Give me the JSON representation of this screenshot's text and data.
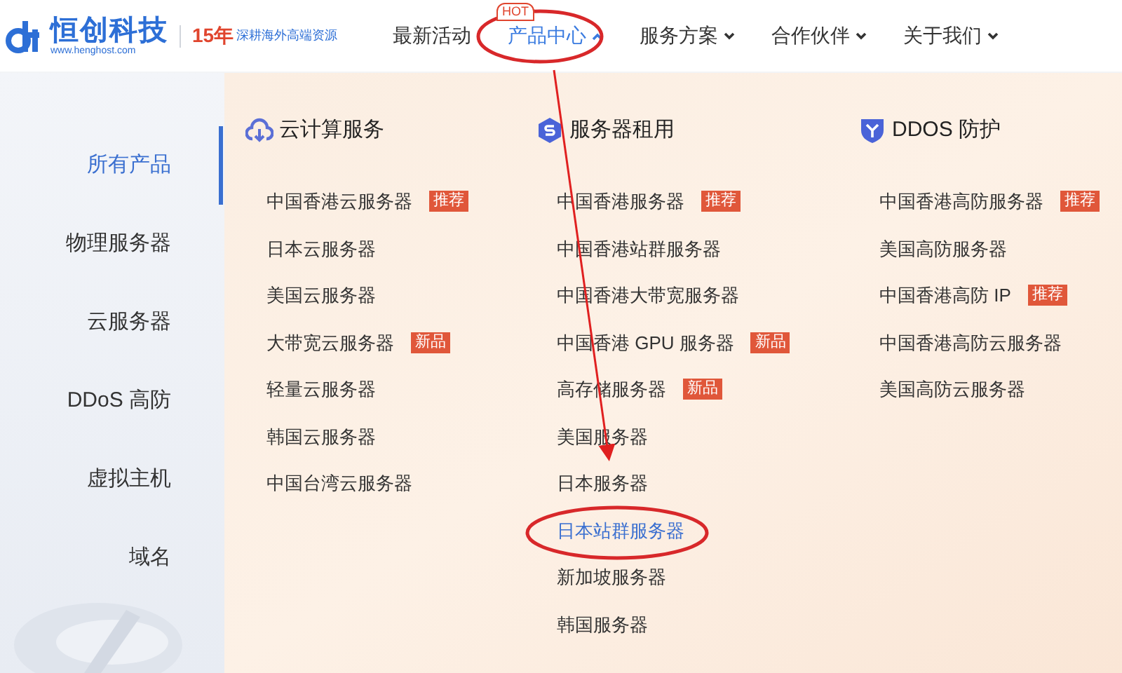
{
  "header": {
    "logo": {
      "name": "恒创科技",
      "url": "www.henghost.com"
    },
    "slogan": {
      "years": "15年",
      "text": "深耕海外高端资源"
    },
    "nav": [
      {
        "label": "最新活动",
        "selected": false,
        "dropdown": false
      },
      {
        "label": "产品中心",
        "selected": true,
        "dropdown": true,
        "badge": "HOT"
      },
      {
        "label": "服务方案",
        "selected": false,
        "dropdown": true
      },
      {
        "label": "合作伙伴",
        "selected": false,
        "dropdown": true
      },
      {
        "label": "关于我们",
        "selected": false,
        "dropdown": true
      }
    ]
  },
  "sidebar": {
    "items": [
      {
        "label": "所有产品",
        "selected": true
      },
      {
        "label": "物理服务器",
        "selected": false
      },
      {
        "label": "云服务器",
        "selected": false
      },
      {
        "label": "DDoS 高防",
        "selected": false
      },
      {
        "label": "虚拟主机",
        "selected": false
      },
      {
        "label": "域名",
        "selected": false
      }
    ]
  },
  "columns": [
    {
      "kind": "cloud",
      "title": "云计算服务",
      "items": [
        {
          "label": "中国香港云服务器",
          "tag": "推荐",
          "selected": false
        },
        {
          "label": "日本云服务器",
          "selected": false
        },
        {
          "label": "美国云服务器",
          "selected": false
        },
        {
          "label": "大带宽云服务器",
          "tag": "新品",
          "selected": false
        },
        {
          "label": "轻量云服务器",
          "selected": false
        },
        {
          "label": "韩国云服务器",
          "selected": false
        },
        {
          "label": "中国台湾云服务器",
          "selected": false
        }
      ]
    },
    {
      "kind": "server",
      "title": "服务器租用",
      "items": [
        {
          "label": "中国香港服务器",
          "tag": "推荐",
          "selected": false
        },
        {
          "label": "中国香港站群服务器",
          "selected": false
        },
        {
          "label": "中国香港大带宽服务器",
          "selected": false
        },
        {
          "label": "中国香港 GPU 服务器",
          "tag": "新品",
          "selected": false
        },
        {
          "label": "高存储服务器",
          "tag": "新品",
          "selected": false
        },
        {
          "label": "美国服务器",
          "selected": false
        },
        {
          "label": "日本服务器",
          "selected": false
        },
        {
          "label": "日本站群服务器",
          "selected": true
        },
        {
          "label": "新加坡服务器",
          "selected": false
        },
        {
          "label": "韩国服务器",
          "selected": false
        }
      ]
    },
    {
      "kind": "shield",
      "title": "DDOS 防护",
      "items": [
        {
          "label": "中国香港高防服务器",
          "tag": "推荐",
          "selected": false
        },
        {
          "label": "美国高防服务器",
          "selected": false
        },
        {
          "label": "中国香港高防 IP",
          "tag": "推荐",
          "selected": false
        },
        {
          "label": "中国香港高防云服务器",
          "selected": false
        },
        {
          "label": "美国高防云服务器",
          "selected": false
        }
      ]
    }
  ]
}
